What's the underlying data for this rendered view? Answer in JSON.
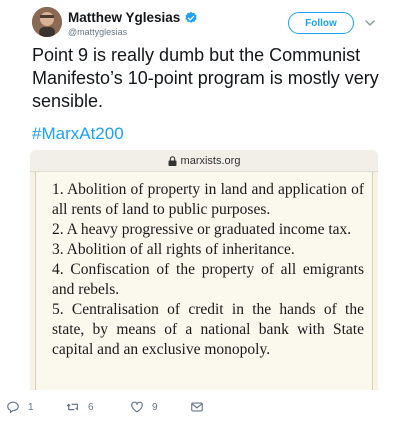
{
  "author": {
    "name": "Matthew Yglesias",
    "handle": "@mattyglesias",
    "verified": true
  },
  "follow_label": "Follow",
  "tweet": {
    "text": "Point 9 is really dumb but the Communist Manifesto’s 10-point program is mostly very sensible.",
    "hashtag": "#MarxAt200"
  },
  "embedded_image": {
    "url": "marxists.org",
    "paragraphs": [
      "1. Abolition of property in land and application of all rents of land to public purposes.",
      "2. A heavy progressive or graduated income tax.",
      "3. Abolition of all rights of inheritance.",
      "4. Confiscation of the property of all emigrants and rebels.",
      "5. Centralisation of credit in the hands of the state, by means of a national bank with State capital and an exclusive monopoly."
    ]
  },
  "actions": {
    "replies": "1",
    "retweets": "6",
    "likes": "9"
  },
  "colors": {
    "accent": "#1da1f2",
    "muted": "#657786"
  }
}
